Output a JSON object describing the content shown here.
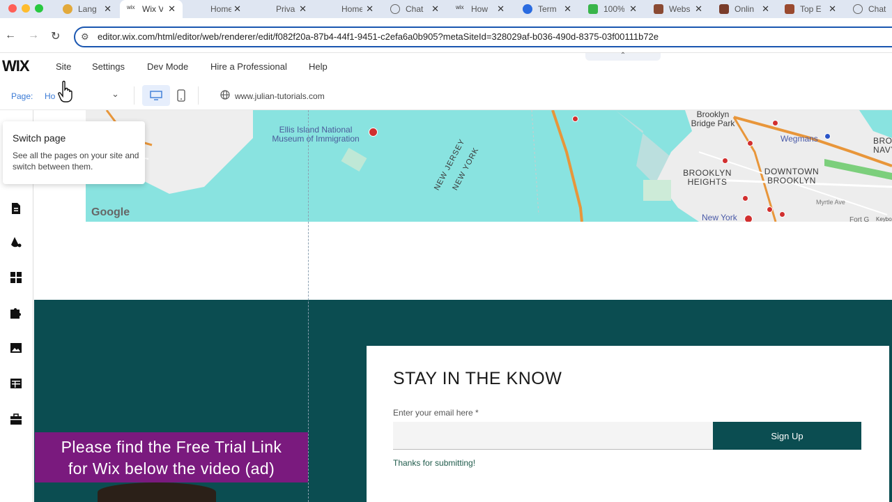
{
  "colors": {
    "wix_teal": "#0b4d51",
    "banner_purple": "#7a1a7e",
    "link_blue": "#3b7bd6",
    "map_water": "#89e3e0"
  },
  "browser": {
    "tabs": [
      {
        "label": "Lang",
        "icon": "medal-icon",
        "active": false
      },
      {
        "label": "Wix V",
        "icon": "wix-icon",
        "active": true
      },
      {
        "label": "Home",
        "icon": "blank-icon",
        "active": false
      },
      {
        "label": "Priva",
        "icon": "blank-icon",
        "active": false
      },
      {
        "label": "Home",
        "icon": "blank-icon",
        "active": false
      },
      {
        "label": "Chat",
        "icon": "chat-icon",
        "active": false
      },
      {
        "label": "How",
        "icon": "wix-icon",
        "active": false
      },
      {
        "label": "Term",
        "icon": "flow-icon",
        "active": false
      },
      {
        "label": "100%",
        "icon": "green-icon",
        "active": false
      },
      {
        "label": "Webs",
        "icon": "avatar-icon",
        "active": false
      },
      {
        "label": "Onlin",
        "icon": "avatar-icon",
        "active": false
      },
      {
        "label": "Top E",
        "icon": "avatar-icon",
        "active": false
      },
      {
        "label": "Chat",
        "icon": "chat-icon",
        "active": false
      }
    ],
    "url": "editor.wix.com/html/editor/web/renderer/edit/f082f20a-87b4-44f1-9451-c2efa6a0b905?metaSiteId=328029af-b036-490d-8375-03f00111b72e"
  },
  "wix_menu": {
    "logo": "WIX",
    "items": [
      "Site",
      "Settings",
      "Dev Mode",
      "Hire a Professional",
      "Help"
    ]
  },
  "page_bar": {
    "page_label": "Page:",
    "page_value": "Ho",
    "site_url": "www.julian-tutorials.com"
  },
  "tooltip": {
    "title": "Switch page",
    "body": "See all the pages on your site and switch between them."
  },
  "map": {
    "labels": [
      "Ellis Island National Museum of Immigration",
      "NEW JERSEY",
      "NEW YORK",
      "Brooklyn Bridge Park",
      "BROOKLYN HEIGHTS",
      "DOWNTOWN BROOKLYN",
      "Wegmans",
      "BROOY NAVY",
      "New York",
      "Myrtle Ave",
      "Fort G",
      "Keyboard"
    ],
    "brand": "Google"
  },
  "form": {
    "title": "STAY IN THE KNOW",
    "email_label": "Enter your email here *",
    "email_value": "",
    "button": "Sign Up",
    "success": "Thanks for submitting!"
  },
  "banner": {
    "line1": "Please find the Free Trial Link",
    "line2": "for Wix below the video (ad)"
  }
}
